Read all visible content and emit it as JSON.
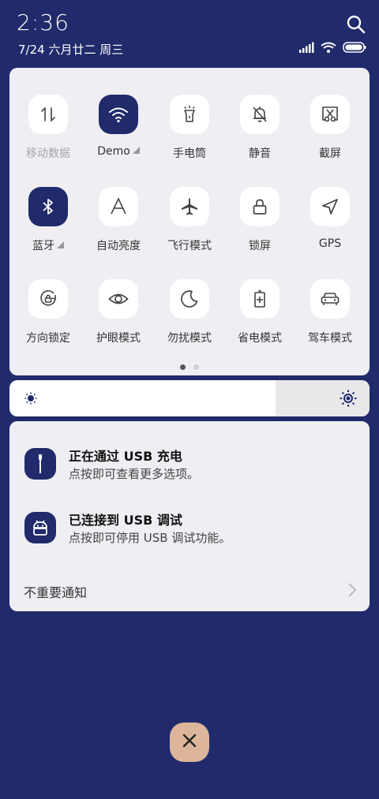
{
  "status": {
    "time": "2:36",
    "date": "7/24 六月廿二 周三"
  },
  "tiles": [
    {
      "label": "移动数据",
      "icon": "mobile-data-icon",
      "active": false,
      "dim": true
    },
    {
      "label": "Demo",
      "icon": "wifi-icon",
      "active": true,
      "dim": false,
      "expand": true
    },
    {
      "label": "手电筒",
      "icon": "flashlight-icon",
      "active": false,
      "dim": false
    },
    {
      "label": "静音",
      "icon": "bell-off-icon",
      "active": false,
      "dim": false
    },
    {
      "label": "截屏",
      "icon": "screenshot-icon",
      "active": false,
      "dim": false
    },
    {
      "label": "蓝牙",
      "icon": "bluetooth-icon",
      "active": true,
      "dim": false,
      "expand": true
    },
    {
      "label": "自动亮度",
      "icon": "auto-brightness-icon",
      "active": false,
      "dim": false
    },
    {
      "label": "飞行模式",
      "icon": "airplane-icon",
      "active": false,
      "dim": false
    },
    {
      "label": "锁屏",
      "icon": "lock-icon",
      "active": false,
      "dim": false
    },
    {
      "label": "GPS",
      "icon": "location-icon",
      "active": false,
      "dim": false
    },
    {
      "label": "方向锁定",
      "icon": "rotation-lock-icon",
      "active": false,
      "dim": false
    },
    {
      "label": "护眼模式",
      "icon": "eye-icon",
      "active": false,
      "dim": false
    },
    {
      "label": "勿扰模式",
      "icon": "moon-icon",
      "active": false,
      "dim": false
    },
    {
      "label": "省电模式",
      "icon": "battery-saver-icon",
      "active": false,
      "dim": false
    },
    {
      "label": "驾车模式",
      "icon": "car-icon",
      "active": false,
      "dim": false
    }
  ],
  "pager": {
    "pages": 2,
    "current": 0
  },
  "brightness": {
    "level": 0.74
  },
  "notifications": [
    {
      "title": "正在通过 USB 充电",
      "subtitle": "点按即可查看更多选项。",
      "icon": "usb-icon"
    },
    {
      "title": "已连接到 USB 调试",
      "subtitle": "点按即可停用 USB 调试功能。",
      "icon": "android-icon"
    }
  ],
  "footer": {
    "label": "不重要通知"
  },
  "colors": {
    "accent": "#212a6b",
    "close": "#dcb59a"
  }
}
